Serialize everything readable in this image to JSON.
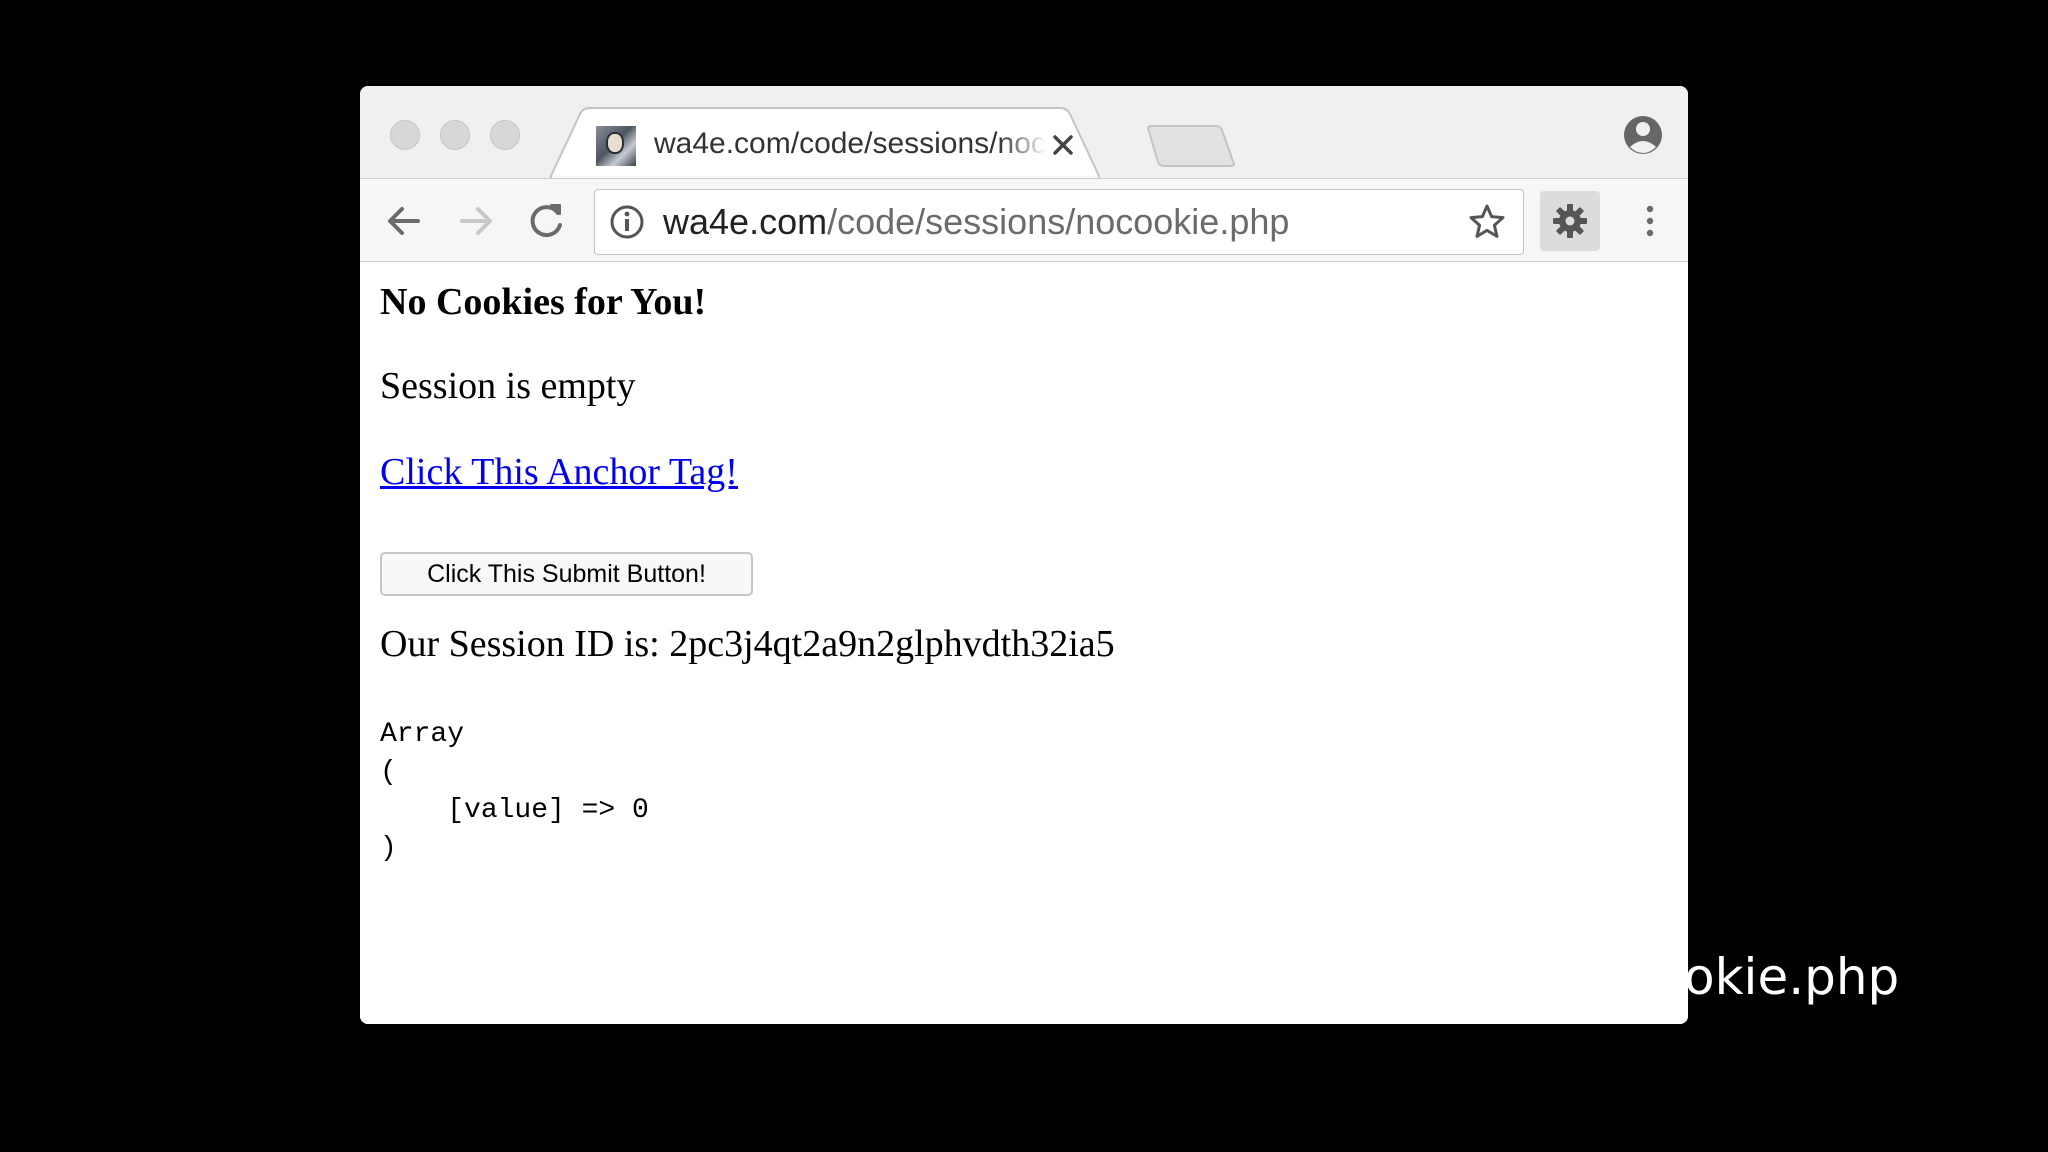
{
  "tab": {
    "title": "wa4e.com/code/sessions/nocookie.php",
    "favicon": "avatar-favicon"
  },
  "omnibox": {
    "host": "wa4e.com",
    "path": "/code/sessions/nocookie.php"
  },
  "page": {
    "heading": "No Cookies for You!",
    "status": "Session is empty",
    "anchor_label": "Click This Anchor Tag!",
    "submit_label": "Click This Submit Button!",
    "session_id_label": "Our Session ID is: 2pc3j4qt2a9n2glphvdth32ia5",
    "dump_lines": [
      "Array",
      "(",
      "    [value] => 0",
      ")"
    ]
  },
  "caption": "okie.php",
  "icons": {
    "back": "arrow-left-icon",
    "forward": "arrow-right-icon",
    "reload": "reload-icon",
    "info": "info-icon",
    "star": "star-icon",
    "extension": "gear-icon",
    "menu": "kebab-menu-icon",
    "profile": "profile-icon",
    "close": "close-icon"
  },
  "colors": {
    "link": "#0000ee",
    "tabstrip": "#f0f0f0",
    "toolbar": "#f6f6f6",
    "backdrop": "#000000"
  }
}
